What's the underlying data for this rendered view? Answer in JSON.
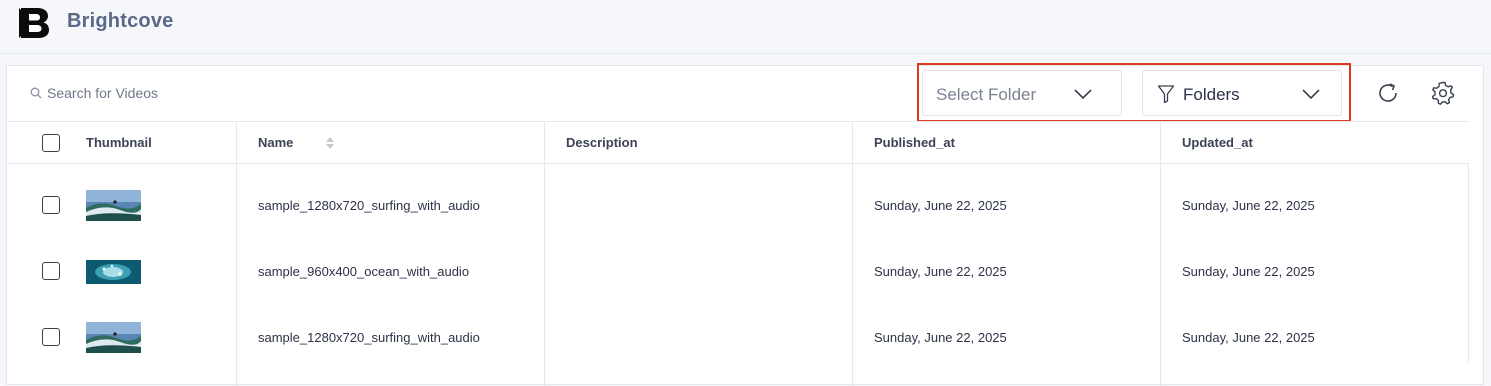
{
  "app": {
    "brand": "Brightcove"
  },
  "toolbar": {
    "search_placeholder": "Search for Videos",
    "folder_select": {
      "placeholder": "Select Folder"
    },
    "filter_select": {
      "value": "Folders"
    }
  },
  "table": {
    "columns": [
      "Thumbnail",
      "Name",
      "Description",
      "Published_at",
      "Updated_at"
    ],
    "rows": [
      {
        "name": "sample_1280x720_surfing_with_audio",
        "description": "",
        "published_at": "Sunday, June 22, 2025",
        "updated_at": "Sunday, June 22, 2025",
        "thumb": "surf"
      },
      {
        "name": "sample_960x400_ocean_with_audio",
        "description": "",
        "published_at": "Sunday, June 22, 2025",
        "updated_at": "Sunday, June 22, 2025",
        "thumb": "ocean"
      },
      {
        "name": "sample_1280x720_surfing_with_audio",
        "description": "",
        "published_at": "Sunday, June 22, 2025",
        "updated_at": "Sunday, June 22, 2025",
        "thumb": "surf"
      }
    ]
  },
  "colors": {
    "highlight": "#e13a1a",
    "brand_text": "#5a6a86"
  }
}
